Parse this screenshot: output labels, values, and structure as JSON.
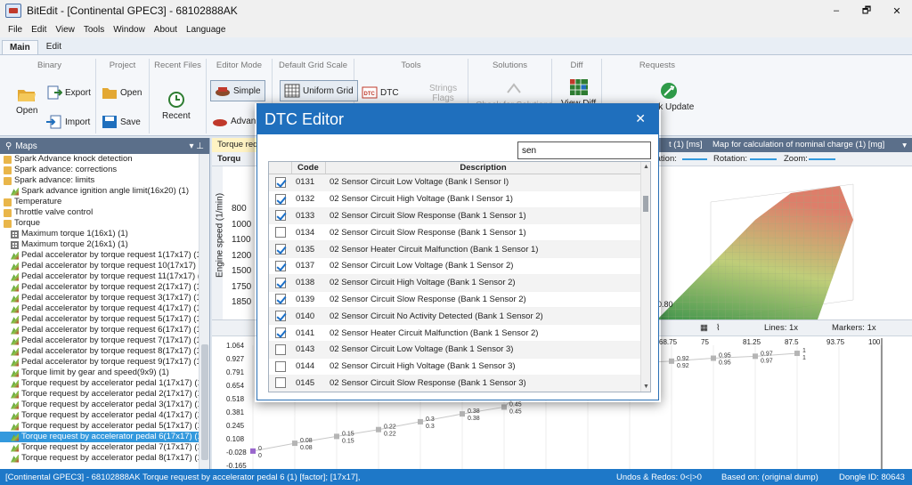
{
  "window": {
    "title": "BitEdit - [Continental GPEC3] - 68102888AK",
    "controls": [
      "–",
      "🗗",
      "✕"
    ]
  },
  "menu": [
    "File",
    "Edit",
    "View",
    "Tools",
    "Window",
    "About",
    "Language"
  ],
  "ribbon_tabs": [
    "Main",
    "Edit"
  ],
  "ribbon": {
    "binary": {
      "title": "Binary",
      "open": "Open",
      "export": "Export",
      "import": "Import"
    },
    "project": {
      "title": "Project",
      "open": "Open",
      "save": "Save"
    },
    "recent": {
      "title": "Recent Files",
      "recent": "Recent"
    },
    "editor_mode": {
      "title": "Editor Mode",
      "simple": "Simple",
      "advanced": "Advan"
    },
    "grid_scale": {
      "title": "Default Grid Scale",
      "uniform": "Uniform Grid"
    },
    "tools": {
      "title": "Tools",
      "dtc": "DTC",
      "strings": "Strings",
      "flags": "Flags"
    },
    "solutions": {
      "title": "Solutions",
      "check": "Check for Solutions"
    },
    "diff": {
      "title": "Diff",
      "view": "View Diff"
    },
    "requests": {
      "title": "Requests",
      "pack_update": "Pack Update"
    }
  },
  "maps_panel": {
    "title": "Maps",
    "items": [
      {
        "label": "Spark Advance knock detection",
        "icon": "folder",
        "indent": 0
      },
      {
        "label": "Spark advance: corrections",
        "icon": "folder",
        "indent": 0
      },
      {
        "label": "Spark advance: limits",
        "icon": "folder",
        "indent": 0
      },
      {
        "label": "Spark advance ignition angle limit(16x20) (1)",
        "icon": "chart3d",
        "indent": 1
      },
      {
        "label": "Temperature",
        "icon": "folder",
        "indent": 0
      },
      {
        "label": "Throttle valve control",
        "icon": "folder",
        "indent": 0
      },
      {
        "label": "Torque",
        "icon": "folder",
        "indent": 0
      },
      {
        "label": "Maximum torque 1(16x1) (1)",
        "icon": "grid",
        "indent": 1
      },
      {
        "label": "Maximum torque 2(16x1) (1)",
        "icon": "grid",
        "indent": 1
      },
      {
        "label": "Pedal accelerator by torque request 1(17x17) (1)",
        "icon": "chart3d",
        "indent": 1
      },
      {
        "label": "Pedal accelerator by torque request 10(17x17) (1)",
        "icon": "chart3d",
        "indent": 1
      },
      {
        "label": "Pedal accelerator by torque request 11(17x17) (1)",
        "icon": "chart3d",
        "indent": 1
      },
      {
        "label": "Pedal accelerator by torque request 2(17x17) (1)",
        "icon": "chart3d",
        "indent": 1
      },
      {
        "label": "Pedal accelerator by torque request 3(17x17) (1)",
        "icon": "chart3d",
        "indent": 1
      },
      {
        "label": "Pedal accelerator by torque request 4(17x17) (1)",
        "icon": "chart3d",
        "indent": 1
      },
      {
        "label": "Pedal accelerator by torque request 5(17x17) (1)",
        "icon": "chart3d",
        "indent": 1
      },
      {
        "label": "Pedal accelerator by torque request 6(17x17) (1)",
        "icon": "chart3d",
        "indent": 1
      },
      {
        "label": "Pedal accelerator by torque request 7(17x17) (1)",
        "icon": "chart3d",
        "indent": 1
      },
      {
        "label": "Pedal accelerator by torque request 8(17x17) (1)",
        "icon": "chart3d",
        "indent": 1
      },
      {
        "label": "Pedal accelerator by torque request 9(17x17) (1)",
        "icon": "chart3d",
        "indent": 1
      },
      {
        "label": "Torque limit by gear and speed(9x9) (1)",
        "icon": "chart3d",
        "indent": 1
      },
      {
        "label": "Torque request by accelerator pedal 1(17x17) (1)",
        "icon": "chart3d",
        "indent": 1
      },
      {
        "label": "Torque request by accelerator pedal 2(17x17) (1)",
        "icon": "chart3d",
        "indent": 1
      },
      {
        "label": "Torque request by accelerator pedal 3(17x17) (1)",
        "icon": "chart3d",
        "indent": 1
      },
      {
        "label": "Torque request by accelerator pedal 4(17x17) (1)",
        "icon": "chart3d",
        "indent": 1
      },
      {
        "label": "Torque request by accelerator pedal 5(17x17) (1)",
        "icon": "chart3d",
        "indent": 1
      },
      {
        "label": "Torque request by accelerator pedal 6(17x17) (1)",
        "icon": "chart3d",
        "indent": 1,
        "selected": true
      },
      {
        "label": "Torque request by accelerator pedal 7(17x17) (1)",
        "icon": "chart3d",
        "indent": 1
      },
      {
        "label": "Torque request by accelerator pedal 8(17x17) (1)",
        "icon": "chart3d",
        "indent": 1
      }
    ]
  },
  "doc_tabs": {
    "active": "Torque requ",
    "tab2": "t (1) [ms]",
    "tab3": "Map for calculation of nominal charge (1) [mg]"
  },
  "map_toolbar": {
    "label": "Torqu",
    "tation": "tation:",
    "rotation": "Rotation:",
    "zoom": "Zoom:"
  },
  "chart3d": {
    "yaxis_label": "Engine speed (1/min)",
    "rpm_labels": [
      "800",
      "1000",
      "1100",
      "1200",
      "1500",
      "1750",
      "1850"
    ],
    "zero_label": "0.80"
  },
  "plot2d": {
    "lines_label": "Lines: 1x",
    "markers_label": "Markers: 1x",
    "x_ticks": [
      "68.75",
      "75",
      "81.25",
      "87.5",
      "93.75",
      "100"
    ],
    "y_ticks": [
      "1.064",
      "0.927",
      "0.791",
      "0.654",
      "0.518",
      "0.381",
      "0.245",
      "0.108",
      "-0.028",
      "-0.165"
    ],
    "points": [
      {
        "x": 0,
        "y": [
          0,
          0
        ]
      },
      {
        "x": 1,
        "y": [
          0.08,
          0.08
        ]
      },
      {
        "x": 2,
        "y": [
          0.15,
          0.15
        ]
      },
      {
        "x": 3,
        "y": [
          0.22,
          0.22
        ]
      },
      {
        "x": 4,
        "y": [
          0.3,
          0.3
        ]
      },
      {
        "x": 5,
        "y": [
          0.38,
          0.38
        ]
      },
      {
        "x": 6,
        "y": [
          0.45,
          0.45
        ]
      },
      {
        "x": 7,
        "y": [
          0.85,
          0.85
        ]
      },
      {
        "x": 8,
        "y": [
          0.88,
          0.88
        ]
      },
      {
        "x": 9,
        "y": [
          0.9,
          0.9
        ]
      },
      {
        "x": 10,
        "y": [
          0.92,
          0.92
        ]
      },
      {
        "x": 11,
        "y": [
          0.95,
          0.95
        ]
      },
      {
        "x": 12,
        "y": [
          0.97,
          0.97
        ]
      },
      {
        "x": 13,
        "y": [
          1,
          1
        ]
      }
    ]
  },
  "dtc_editor": {
    "title": "DTC Editor",
    "search_value": "sen",
    "columns": {
      "code": "Code",
      "description": "Description"
    },
    "rows": [
      {
        "checked": true,
        "code": "0131",
        "desc": "02 Sensor Circuit Low Voltage (Bank I Sensor I)"
      },
      {
        "checked": true,
        "code": "0132",
        "desc": "02 Sensor Circuit High Voltage (Bank I Sensor 1)"
      },
      {
        "checked": true,
        "code": "0133",
        "desc": "02 Sensor Circuit Slow Response (Bank 1 Sensor 1)"
      },
      {
        "checked": false,
        "code": "0134",
        "desc": "02 Sensor Circuit Slow Response (Bank 1 Sensor 1)"
      },
      {
        "checked": true,
        "code": "0135",
        "desc": "02 Sensor Heater Circuit Malfunction (Bank 1 Sensor 1)"
      },
      {
        "checked": true,
        "code": "0137",
        "desc": "02 Sensor Circuit Low Voltage (Bank 1 Sensor 2)"
      },
      {
        "checked": true,
        "code": "0138",
        "desc": "02 Sensor Circuit High Voltage (Bank 1 Sensor 2)"
      },
      {
        "checked": true,
        "code": "0139",
        "desc": "02 Sensor Circuit Slow Response (Bank 1 Sensor 2)"
      },
      {
        "checked": true,
        "code": "0140",
        "desc": "02 Sensor Circuit No Activity Detected (Bank 1 Sensor 2)"
      },
      {
        "checked": true,
        "code": "0141",
        "desc": "02 Sensor Heater Circuit Malfunction (Bank 1 Sensor 2)"
      },
      {
        "checked": false,
        "code": "0143",
        "desc": "02 Sensor Circuit Low Voltage (Bank 1 Sensor 3)"
      },
      {
        "checked": false,
        "code": "0144",
        "desc": "02 Sensor Circuit High Voltage (Bank 1 Sensor 3)"
      },
      {
        "checked": false,
        "code": "0145",
        "desc": "02 Sensor Circuit Slow Response (Bank 1 Sensor 3)"
      }
    ]
  },
  "statusbar": {
    "ecu": "[Continental GPEC3] - 68102888AK",
    "map": "Torque request by accelerator pedal 6 (1) [factor]; [17x17],",
    "undos": "Undos & Redos: 0<|>0",
    "based_on": "Based on: (original dump)",
    "dongle": "Dongle ID: 80643"
  },
  "colors": {
    "accent": "#1f6fbd",
    "status": "#1e78c8",
    "selection": "#3399dd",
    "panel_header": "#5b6f8a"
  }
}
